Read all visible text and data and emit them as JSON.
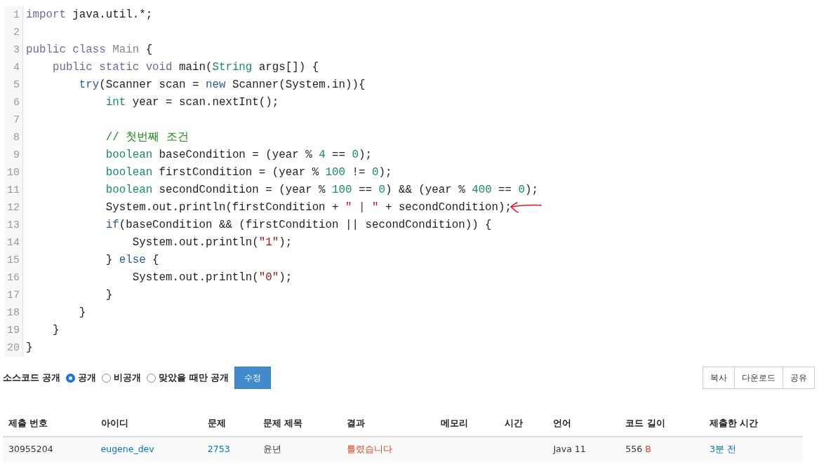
{
  "code": {
    "lines": [
      {
        "number": "1",
        "marked": false,
        "tokens": [
          {
            "kind": "meta",
            "text": "import"
          },
          {
            "kind": "plain",
            "text": " java.util.*;"
          }
        ]
      },
      {
        "number": "2",
        "marked": false
      },
      {
        "number": "3",
        "marked": false,
        "tokens": [
          {
            "kind": "meta",
            "text": "public class"
          },
          {
            "kind": "def",
            "text": " Main"
          },
          {
            "kind": "plain",
            "text": " {"
          }
        ]
      },
      {
        "number": "4",
        "marked": false,
        "tokens": [
          {
            "kind": "meta",
            "text": "    public static void"
          },
          {
            "kind": "plain",
            "text": " main("
          },
          {
            "kind": "type",
            "text": "String"
          },
          {
            "kind": "plain",
            "text": " args[]) {"
          }
        ]
      },
      {
        "number": "5",
        "marked": false,
        "tokens": [
          {
            "kind": "keyword",
            "text": "        try"
          },
          {
            "kind": "plain",
            "text": "(Scanner scan = "
          },
          {
            "kind": "keyword",
            "text": "new"
          },
          {
            "kind": "plain",
            "text": " Scanner(System.in)){"
          }
        ]
      },
      {
        "number": "6",
        "marked": false,
        "tokens": [
          {
            "kind": "type",
            "text": "            int"
          },
          {
            "kind": "plain",
            "text": " year = scan.nextInt();"
          }
        ]
      },
      {
        "number": "7",
        "marked": false
      },
      {
        "number": "8",
        "marked": false,
        "tokens": [
          {
            "kind": "comment",
            "text": "            // 첫번째 조건"
          }
        ]
      },
      {
        "number": "9",
        "marked": false,
        "tokens": [
          {
            "kind": "type",
            "text": "            boolean"
          },
          {
            "kind": "plain",
            "text": " baseCondition = (year % "
          },
          {
            "kind": "number",
            "text": "4"
          },
          {
            "kind": "plain",
            "text": " == "
          },
          {
            "kind": "number",
            "text": "0"
          },
          {
            "kind": "plain",
            "text": ");"
          }
        ]
      },
      {
        "number": "10",
        "marked": false,
        "tokens": [
          {
            "kind": "type",
            "text": "            boolean"
          },
          {
            "kind": "plain",
            "text": " firstCondition = (year % "
          },
          {
            "kind": "number",
            "text": "100"
          },
          {
            "kind": "plain",
            "text": " != "
          },
          {
            "kind": "number",
            "text": "0"
          },
          {
            "kind": "plain",
            "text": ");"
          }
        ]
      },
      {
        "number": "11",
        "marked": false,
        "tokens": [
          {
            "kind": "type",
            "text": "            boolean"
          },
          {
            "kind": "plain",
            "text": " secondCondition = (year % "
          },
          {
            "kind": "number",
            "text": "100"
          },
          {
            "kind": "plain",
            "text": " == "
          },
          {
            "kind": "number",
            "text": "0"
          },
          {
            "kind": "plain",
            "text": ") && (year % "
          },
          {
            "kind": "number",
            "text": "400"
          },
          {
            "kind": "plain",
            "text": " == "
          },
          {
            "kind": "number",
            "text": "0"
          },
          {
            "kind": "plain",
            "text": ");"
          }
        ]
      },
      {
        "number": "12",
        "marked": true,
        "tokens": [
          {
            "kind": "plain",
            "text": "            System.out.println(firstCondition + "
          },
          {
            "kind": "string",
            "text": "\" | \""
          },
          {
            "kind": "plain",
            "text": " + secondCondition);"
          }
        ]
      },
      {
        "number": "13",
        "marked": false,
        "tokens": [
          {
            "kind": "keyword",
            "text": "            if"
          },
          {
            "kind": "plain",
            "text": "(baseCondition && (firstCondition || secondCondition)) {"
          }
        ]
      },
      {
        "number": "14",
        "marked": false,
        "tokens": [
          {
            "kind": "plain",
            "text": "                System.out.println("
          },
          {
            "kind": "string",
            "text": "\"1\""
          },
          {
            "kind": "plain",
            "text": ");"
          }
        ]
      },
      {
        "number": "15",
        "marked": false,
        "tokens": [
          {
            "kind": "plain",
            "text": "            } "
          },
          {
            "kind": "keyword",
            "text": "else"
          },
          {
            "kind": "plain",
            "text": " {"
          }
        ]
      },
      {
        "number": "16",
        "marked": false,
        "tokens": [
          {
            "kind": "plain",
            "text": "                System.out.println("
          },
          {
            "kind": "string",
            "text": "\"0\""
          },
          {
            "kind": "plain",
            "text": ");"
          }
        ]
      },
      {
        "number": "17",
        "marked": false,
        "tokens": [
          {
            "kind": "plain",
            "text": "            }"
          }
        ]
      },
      {
        "number": "18",
        "marked": false,
        "tokens": [
          {
            "kind": "plain",
            "text": "        }"
          }
        ]
      },
      {
        "number": "19",
        "marked": false,
        "tokens": [
          {
            "kind": "plain",
            "text": "    }"
          }
        ]
      },
      {
        "number": "20",
        "marked": false,
        "tokens": [
          {
            "kind": "plain",
            "text": "}"
          }
        ]
      }
    ]
  },
  "visibility": {
    "label": "소스코드 공개",
    "options": [
      {
        "label": "공개",
        "selected": true
      },
      {
        "label": "비공개",
        "selected": false
      },
      {
        "label": "맞았을 때만 공개",
        "selected": false
      }
    ],
    "submit": "수정"
  },
  "actions": [
    "복사",
    "다운로드",
    "공유"
  ],
  "table": {
    "columns": [
      "제출 번호",
      "아이디",
      "문제",
      "문제 제목",
      "결과",
      "메모리",
      "시간",
      "언어",
      "코드 길이",
      "제출한 시간"
    ],
    "rows": [
      [
        {
          "kind": "text",
          "text": "30955204"
        },
        {
          "kind": "link",
          "text": "eugene_dev"
        },
        {
          "kind": "link",
          "text": "2753"
        },
        {
          "kind": "text",
          "text": "윤년"
        },
        {
          "kind": "wrong",
          "text": "틀렸습니다"
        },
        {
          "kind": "empty"
        },
        {
          "kind": "empty"
        },
        {
          "kind": "text",
          "text": "Java 11"
        },
        {
          "kind": "size",
          "text": "556",
          "unit": "B"
        },
        {
          "kind": "link",
          "text": "3분 전"
        }
      ]
    ]
  }
}
